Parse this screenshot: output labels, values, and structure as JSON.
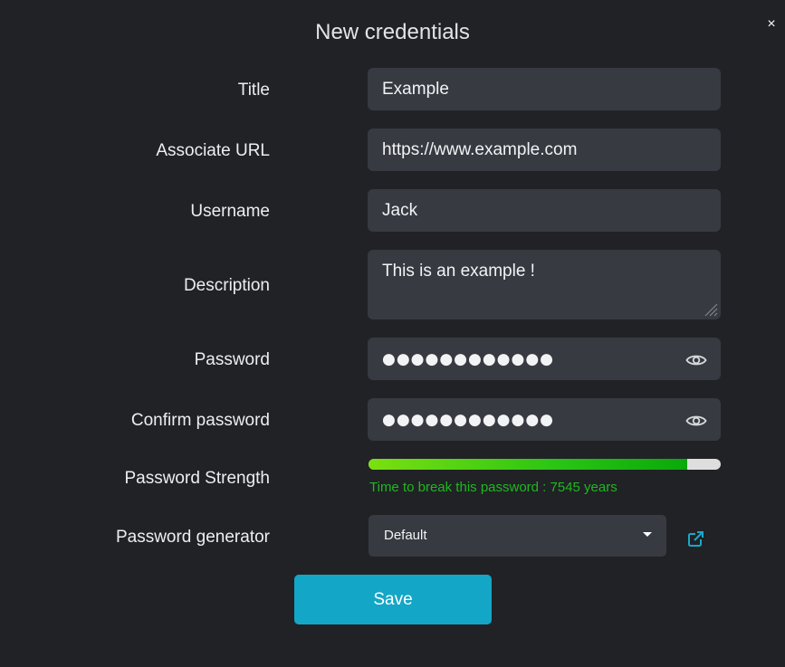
{
  "dialog": {
    "title": "New credentials",
    "close_label": "×"
  },
  "form": {
    "title_label": "Title",
    "title_value": "Example",
    "url_label": "Associate URL",
    "url_value": "https://www.example.com",
    "username_label": "Username",
    "username_value": "Jack",
    "description_label": "Description",
    "description_value": "This is an example !",
    "password_label": "Password",
    "password_value": "●●●●●●●●●●●●",
    "confirm_label": "Confirm password",
    "confirm_value": "●●●●●●●●●●●●",
    "strength_label": "Password Strength",
    "strength_fraction": 0.906,
    "strength_text": "Time to break this password : 7545 years",
    "generator_label": "Password generator",
    "generator_value": "Default",
    "save_label": "Save"
  },
  "icons": {
    "password_toggle": "eye-icon",
    "confirm_toggle": "eye-icon",
    "generator_open": "external-link-icon",
    "select_caret": "caret-down-icon"
  },
  "colors": {
    "background": "#202226",
    "field": "#373a41",
    "accent": "#14a6c6",
    "strength_text": "#1fb81f",
    "strength_fill": "#29c414"
  }
}
